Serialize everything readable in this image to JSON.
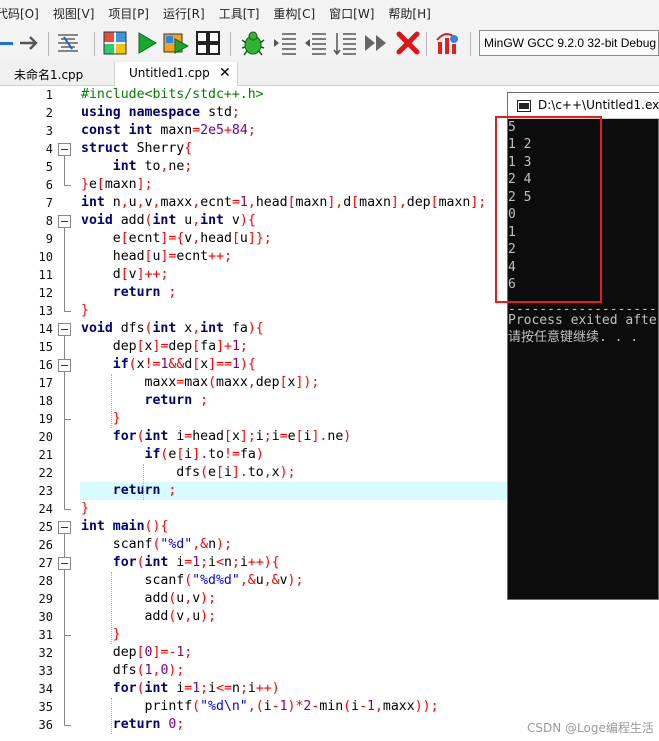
{
  "menubar": {
    "items": [
      "代码[O]",
      "视图[V]",
      "项目[P]",
      "运行[R]",
      "工具[T]",
      "重构[C]",
      "窗口[W]",
      "帮助[H]"
    ]
  },
  "toolbar": {
    "icons": [
      "minus-icon",
      "arrow-right-icon",
      "align-icon",
      "insert-block-icon",
      "run-icon",
      "compile-run-icon",
      "grid-icon",
      "debug-bug-icon",
      "indent-icon",
      "unindent-icon",
      "line-numbers-icon",
      "fast-forward-icon",
      "stop-icon",
      "profile-icon"
    ],
    "compiler": "MinGW GCC 9.2.0 32-bit Debug"
  },
  "tabs": [
    {
      "label": "未命名1.cpp",
      "active": false
    },
    {
      "label": "Untitled1.cpp",
      "active": true
    }
  ],
  "editor": {
    "line_numbers": [
      "1",
      "2",
      "3",
      "4",
      "5",
      "6",
      "7",
      "8",
      "9",
      "10",
      "11",
      "12",
      "13",
      "14",
      "15",
      "16",
      "17",
      "18",
      "19",
      "20",
      "21",
      "22",
      "23",
      "24",
      "25",
      "26",
      "27",
      "28",
      "29",
      "30",
      "31",
      "32",
      "33",
      "34",
      "35",
      "36"
    ],
    "current_line": "23",
    "lines": [
      "#include<bits/stdc++.h>",
      "using namespace std;",
      "const int maxn=2e5+84;",
      "struct Sherry{",
      "    int to,ne;",
      "}e[maxn];",
      "int n,u,v,maxx,ecnt=1,head[maxn],d[maxn],dep[maxn];",
      "void add(int u,int v){",
      "    e[ecnt]={v,head[u]};",
      "    head[u]=ecnt++;",
      "    d[v]++;",
      "    return ;",
      "}",
      "void dfs(int x,int fa){",
      "    dep[x]=dep[fa]+1;",
      "    if(x!=1&&d[x]==1){",
      "        maxx=max(maxx,dep[x]);",
      "        return ;",
      "    }",
      "    for(int i=head[x];i;i=e[i].ne)",
      "        if(e[i].to!=fa)",
      "            dfs(e[i].to,x);",
      "    return ;",
      "}",
      "int main(){",
      "    scanf(\"%d\",&n);",
      "    for(int i=1;i<n;i++){",
      "        scanf(\"%d%d\",&u,&v);",
      "        add(u,v);",
      "        add(v,u);",
      "    }",
      "    dep[0]=-1;",
      "    dfs(1,0);",
      "    for(int i=1;i<=n;i++)",
      "        printf(\"%d\\n\",(i-1)*2-min(i-1,maxx));",
      "    return 0;"
    ]
  },
  "console": {
    "title": "D:\\c++\\Untitled1.exe",
    "lines": [
      "5",
      "1 2",
      "1 3",
      "2 4",
      "2 5",
      "0",
      "1",
      "2",
      "4",
      "6"
    ],
    "separator": "--------------------",
    "exit_message": "Process exited afte",
    "press_key": "请按任意键继续. . ."
  },
  "watermark": "CSDN @Loge编程生活",
  "colors": {
    "keyword": "#000080",
    "symbol": "#ff0000",
    "number": "#800080",
    "string": "#0000ff",
    "preprocessor": "#008000",
    "current_line_bg": "#d8fbff",
    "highlight_box": "#e02020"
  }
}
